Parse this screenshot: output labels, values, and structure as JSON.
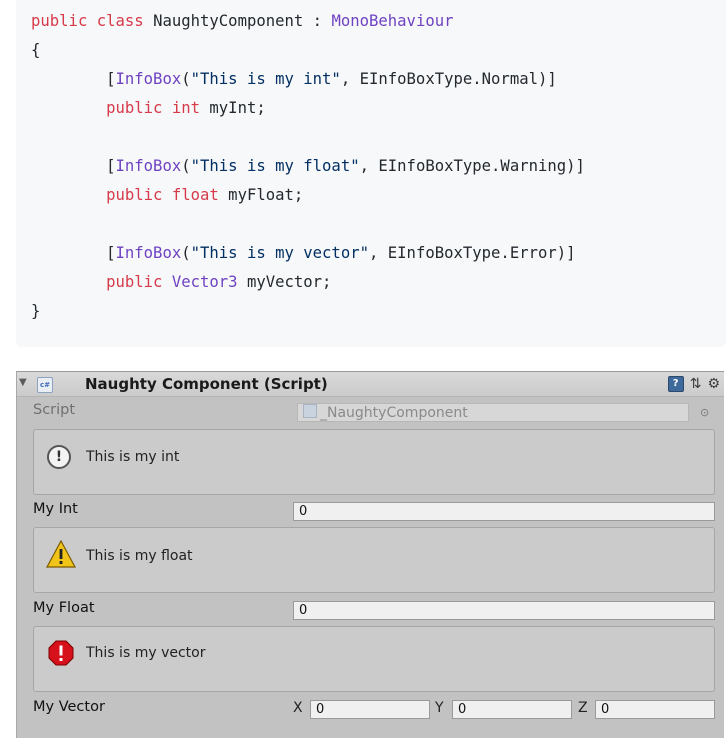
{
  "code": {
    "lines": [
      "public class NaughtyComponent : MonoBehaviour",
      "{",
      "    [InfoBox(\"This is my int\", EInfoBoxType.Normal)]",
      "    public int myInt;",
      "",
      "    [InfoBox(\"This is my float\", EInfoBoxType.Warning)]",
      "    public float myFloat;",
      "",
      "    [InfoBox(\"This is my vector\", EInfoBoxType.Error)]",
      "    public Vector3 myVector;",
      "}"
    ]
  },
  "inspector": {
    "title": "Naughty Component (Script)",
    "script_label": "Script",
    "script_value": "_NaughtyComponent",
    "infos": {
      "int": "This is my int",
      "float": "This is my float",
      "vector": "This is my vector"
    },
    "fields": {
      "int_label": "My Int",
      "int_value": "0",
      "float_label": "My Float",
      "float_value": "0",
      "vector_label": "My Vector",
      "vector_x_label": "X",
      "vector_x": "0",
      "vector_y_label": "Y",
      "vector_y": "0",
      "vector_z_label": "Z",
      "vector_z": "0"
    },
    "icons": [
      "foldout-arrow-icon",
      "csharp-script-icon",
      "help-icon",
      "presets-icon",
      "gear-icon",
      "info-icon",
      "warning-icon",
      "error-icon",
      "object-picker-icon"
    ],
    "colors": {
      "info_icon": "#555555",
      "warning_icon": "#f0c419",
      "error_icon": "#d6111b"
    }
  }
}
